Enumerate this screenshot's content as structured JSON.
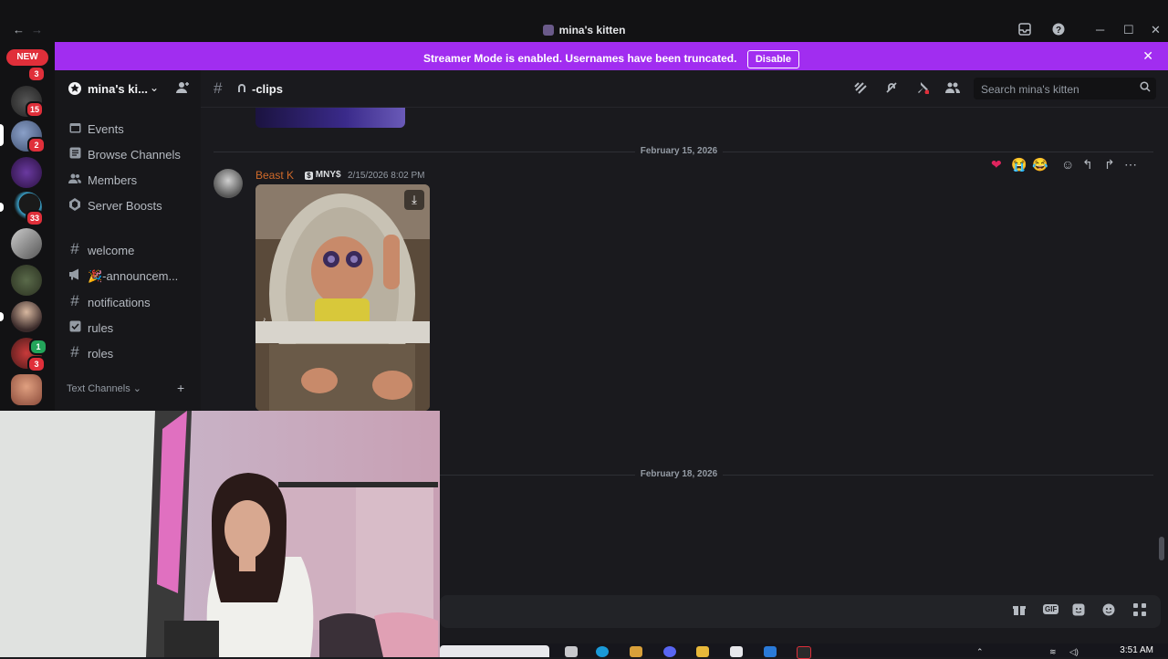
{
  "window": {
    "title": "mina's kitten",
    "back_icon": "←",
    "forward_icon": "→"
  },
  "titlebar_buttons": {
    "inbox": "inbox-icon",
    "help": "?",
    "minimize": "─",
    "maximize": "☐",
    "close": "✕"
  },
  "banner": {
    "text": "Streamer Mode is enabled. Usernames have been truncated.",
    "disable_label": "Disable",
    "color": "#a12df0"
  },
  "server_rail": {
    "new_label": "NEW",
    "badges": [
      "3",
      "15",
      "2",
      "33",
      "3"
    ]
  },
  "sidebar": {
    "server_name": "mina's ki...",
    "items": [
      {
        "icon": "calendar-icon",
        "label": "Events"
      },
      {
        "icon": "browse-icon",
        "label": "Browse Channels"
      },
      {
        "icon": "members-icon",
        "label": "Members"
      },
      {
        "icon": "boost-icon",
        "label": "Server Boosts"
      }
    ],
    "channels": [
      {
        "icon": "#",
        "label": "welcome"
      },
      {
        "icon": "megaphone-icon",
        "label": "🎉-announcem..."
      },
      {
        "icon": "#",
        "label": "notifications"
      },
      {
        "icon": "rules-icon",
        "label": "rules"
      },
      {
        "icon": "#",
        "label": "roles"
      }
    ],
    "category": "Text Channels"
  },
  "channel": {
    "name": "-clips",
    "search_placeholder": "Search mina's kitten"
  },
  "messages": {
    "date_1": "February 15, 2026",
    "date_2": "February 18, 2026",
    "author": "Beast K",
    "author_color": "#d06a2a",
    "tag": "MNY$",
    "timestamp": "2/15/2026 8:02 PM",
    "reactions": [
      "❤",
      "😭",
      "😂"
    ]
  },
  "taskbar": {
    "time": "3:51 AM"
  }
}
